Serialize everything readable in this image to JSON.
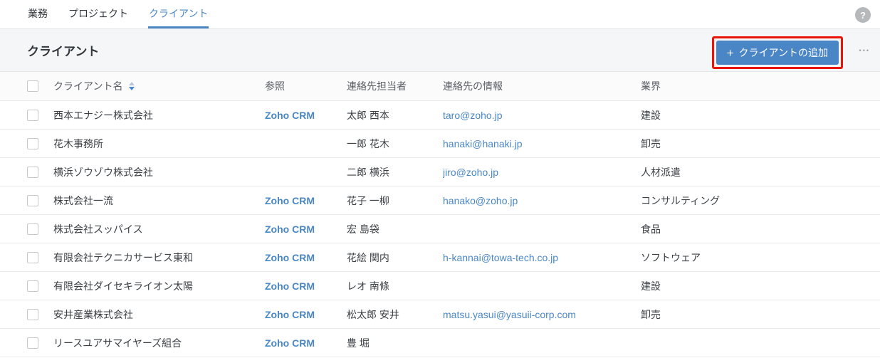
{
  "tabs": [
    {
      "label": "業務",
      "active": false
    },
    {
      "label": "プロジェクト",
      "active": false
    },
    {
      "label": "クライアント",
      "active": true
    }
  ],
  "help": {
    "icon": "?"
  },
  "page": {
    "title": "クライアント"
  },
  "toolbar": {
    "add_button_plus": "+",
    "add_button_label": "クライアントの追加",
    "more_icon": "•••"
  },
  "table": {
    "headers": {
      "name": "クライアント名",
      "reference": "参照",
      "contact_person": "連絡先担当者",
      "contact_info": "連絡先の情報",
      "industry": "業界"
    },
    "rows": [
      {
        "name": "西本エナジー株式会社",
        "reference": "Zoho CRM",
        "contact_person": "太郎 西本",
        "contact_info": "taro@zoho.jp",
        "industry": "建設"
      },
      {
        "name": "花木事務所",
        "reference": "",
        "contact_person": "一郎 花木",
        "contact_info": "hanaki@hanaki.jp",
        "industry": "卸売"
      },
      {
        "name": "横浜ゾウゾウ株式会社",
        "reference": "",
        "contact_person": "二郎 横浜",
        "contact_info": "jiro@zoho.jp",
        "industry": "人材派遣"
      },
      {
        "name": "株式会社一流",
        "reference": "Zoho CRM",
        "contact_person": "花子 一柳",
        "contact_info": "hanako@zoho.jp",
        "industry": "コンサルティング"
      },
      {
        "name": "株式会社スッパイス",
        "reference": "Zoho CRM",
        "contact_person": "宏 島袋",
        "contact_info": "",
        "industry": "食品"
      },
      {
        "name": "有限会社テクニカサービス東和",
        "reference": "Zoho CRM",
        "contact_person": "花絵 関内",
        "contact_info": "h-kannai@towa-tech.co.jp",
        "industry": "ソフトウェア"
      },
      {
        "name": "有限会社ダイセキライオン太陽",
        "reference": "Zoho CRM",
        "contact_person": "レオ 南條",
        "contact_info": "",
        "industry": "建設"
      },
      {
        "name": "安井産業株式会社",
        "reference": "Zoho CRM",
        "contact_person": "松太郎 安井",
        "contact_info": "matsu.yasui@yasuii-corp.com",
        "industry": "卸売"
      },
      {
        "name": "リースユアサマイヤーズ組合",
        "reference": "Zoho CRM",
        "contact_person": "豊 堀",
        "contact_info": "",
        "industry": ""
      }
    ]
  },
  "colors": {
    "accent_blue": "#4a87c7",
    "button_blue": "#4a86c6",
    "annotation_red": "#ea1408",
    "band_gray": "#f5f6f8"
  }
}
